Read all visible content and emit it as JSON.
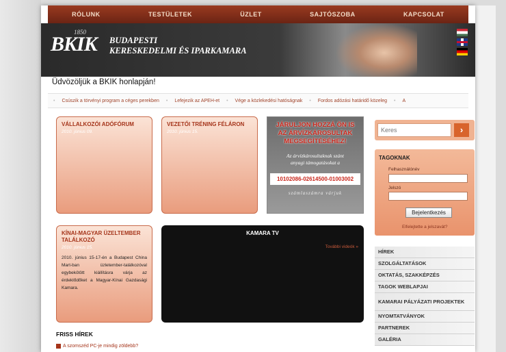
{
  "nav": [
    "RÓLUNK",
    "TESTÜLETEK",
    "ÜZLET",
    "SAJTÓSZOBA",
    "KAPCSOLAT"
  ],
  "banner": {
    "year": "1850",
    "logo": "BKIK",
    "title_line1": "BUDAPESTI",
    "title_line2": "KERESKEDELMI ÉS IPARKAMARA"
  },
  "welcome": "Üdvözöljük a BKIK honlapján!",
  "ticker": [
    "Csúszik a törvényi program a céges perekben",
    "Lefejezik az APEH-et",
    "Vége a közlekedési hatóságnak",
    "Fordos adózási határidő közeleg",
    "A"
  ],
  "cards": [
    {
      "title": "VÁLLALKOZÓI ADÓFÓRUM",
      "date": "2010. június 09.",
      "body": ""
    },
    {
      "title": "VEZETŐI TRÉNING FÉLÁRON",
      "date": "2010. június 15.",
      "body": ""
    },
    {
      "title": "KÍNAI-MAGYAR ÜZELTEMBER TALÁLKOZÓ",
      "date": "2010. június 15.",
      "body": "2010. június 15-17-én a Budapest China Mart-ban üzletember-találkozóval egybekötött kiállításra várja az érdeklődőket a Magyar-Kínai Gazdasági Kamara."
    }
  ],
  "ad": {
    "head_1": "JÁRULJON HOZZÁ ÖN IS",
    "head_2": "AZ ÁRVÍZKÁROSULTAK",
    "head_3": "MEGSEGÍTÉSÉHEZ!",
    "sub_1": "Az árvízkárosultaknak szánt",
    "sub_2": "anyagi támogatásokat a",
    "account": "10102086-02614500-01003002",
    "foot": "számlaszámra várjuk"
  },
  "tv": {
    "title": "KAMARA TV",
    "more": "További videók »"
  },
  "friss": {
    "title": "FRISS HÍREK",
    "item": "A szomszéd PC-je mindig zöldebb?"
  },
  "search": {
    "placeholder": "Keres",
    "button": "›"
  },
  "login": {
    "title": "TAGOKNAK",
    "username_label": "Felhasználónév",
    "password_label": "Jelszó",
    "submit": "Bejelentkezés",
    "forgot": "Elfelejtette a jelszavát?"
  },
  "menu": [
    "HÍREK",
    "SZOLGÁLTATÁSOK",
    "OKTATÁS, SZAKKÉPZÉS",
    "TAGOK WEBLAPJAI",
    "KAMARAI PÁLYÁZATI PROJEKTEK",
    "NYOMTATVÁNYOK",
    "PARTNEREK",
    "GALÉRIA"
  ]
}
